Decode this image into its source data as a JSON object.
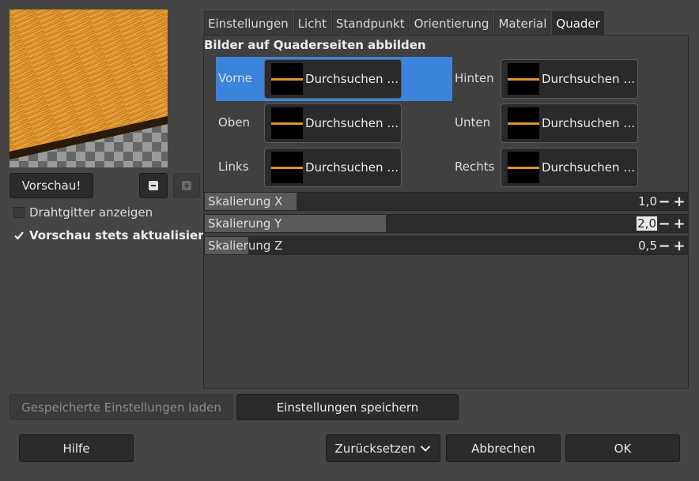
{
  "preview": {
    "button_label": "Vorschau!",
    "zoom_out_icon": "minus-icon",
    "zoom_in_icon": "plus-icon",
    "wireframe_label": "Drahtgitter anzeigen",
    "wireframe_checked": false,
    "auto_update_label": "Vorschau stets aktualisieren",
    "auto_update_checked": true
  },
  "tabs": [
    {
      "label": "Einstellungen",
      "active": false
    },
    {
      "label": "Licht",
      "active": false
    },
    {
      "label": "Standpunkt",
      "active": false
    },
    {
      "label": "Orientierung",
      "active": false
    },
    {
      "label": "Material",
      "active": false
    },
    {
      "label": "Quader",
      "active": true
    }
  ],
  "box": {
    "title": "Bilder auf Quaderseiten abbilden",
    "faces": [
      {
        "label": "Vorne",
        "browse": "Durchsuchen …",
        "selected": true
      },
      {
        "label": "Hinten",
        "browse": "Durchsuchen …",
        "selected": false
      },
      {
        "label": "Oben",
        "browse": "Durchsuchen …",
        "selected": false
      },
      {
        "label": "Unten",
        "browse": "Durchsuchen …",
        "selected": false
      },
      {
        "label": "Links",
        "browse": "Durchsuchen …",
        "selected": false
      },
      {
        "label": "Rechts",
        "browse": "Durchsuchen …",
        "selected": false
      }
    ],
    "scales": [
      {
        "label": "Skalierung X",
        "value": "1,0",
        "fraction": 0.19
      },
      {
        "label": "Skalierung Y",
        "value": "2,0",
        "fraction": 0.375
      },
      {
        "label": "Skalierung Z",
        "value": "0,5",
        "fraction": 0.09
      }
    ]
  },
  "footer": {
    "load_label": "Gespeicherte Einstellungen laden",
    "save_label": "Einstellungen speichern",
    "help_label": "Hilfe",
    "reset_label": "Zurücksetzen",
    "cancel_label": "Abbrechen",
    "ok_label": "OK"
  },
  "colors": {
    "background": "#454545",
    "highlight": "#3a85db",
    "wood": "#e0922a"
  }
}
